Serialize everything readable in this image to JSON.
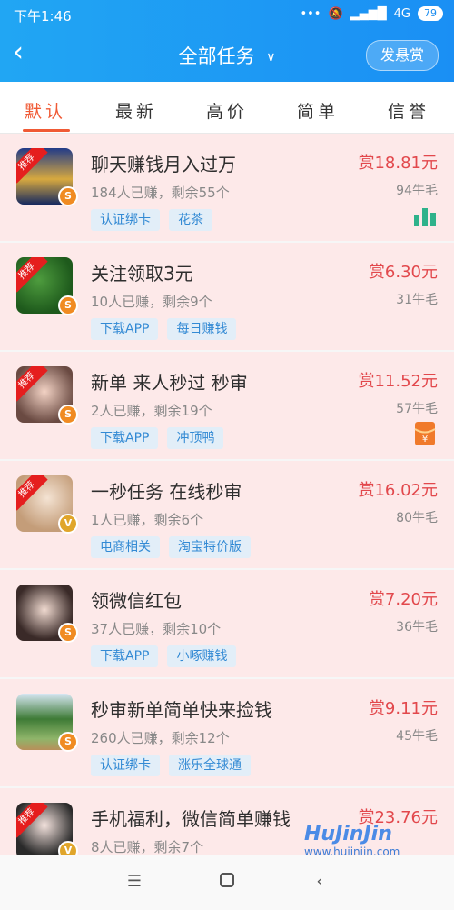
{
  "status": {
    "time": "下午1:46",
    "network": "4G",
    "battery": "79"
  },
  "header": {
    "title": "全部任务",
    "action": "发悬赏"
  },
  "tabs": [
    "默认",
    "最新",
    "高价",
    "简单",
    "信誉"
  ],
  "colors": {
    "brand": "#1d92f3",
    "accent": "#f05a35",
    "reward": "#e2484c",
    "tag_text": "#338ad4",
    "tag_bg": "#e2eef8"
  },
  "tasks": [
    {
      "title": "聊天赚钱月入过万",
      "stats": "184人已赚，剩余55个",
      "reward": "赏18.81元",
      "points": "94牛毛",
      "tags": [
        "认证绑卡",
        "花茶"
      ],
      "badge": "S",
      "ribbon": "推荐",
      "side_icon": "chart-icon"
    },
    {
      "title": "关注领取3元",
      "stats": "10人已赚，剩余9个",
      "reward": "赏6.30元",
      "points": "31牛毛",
      "tags": [
        "下载APP",
        "每日赚钱"
      ],
      "badge": "S",
      "ribbon": "推荐"
    },
    {
      "title": "新单 来人秒过 秒审",
      "stats": "2人已赚，剩余19个",
      "reward": "赏11.52元",
      "points": "57牛毛",
      "tags": [
        "下载APP",
        "冲顶鸭"
      ],
      "badge": "S",
      "ribbon": "推荐",
      "side_icon": "red-envelope-icon"
    },
    {
      "title": "一秒任务 在线秒审",
      "stats": "1人已赚，剩余6个",
      "reward": "赏16.02元",
      "points": "80牛毛",
      "tags": [
        "电商相关",
        "淘宝特价版"
      ],
      "badge": "V",
      "ribbon": "推荐"
    },
    {
      "title": "领微信红包",
      "stats": "37人已赚，剩余10个",
      "reward": "赏7.20元",
      "points": "36牛毛",
      "tags": [
        "下载APP",
        "小啄赚钱"
      ],
      "badge": "S"
    },
    {
      "title": "秒审新单简单快来捡钱",
      "stats": "260人已赚，剩余12个",
      "reward": "赏9.11元",
      "points": "45牛毛",
      "tags": [
        "认证绑卡",
        "涨乐全球通"
      ],
      "badge": "S"
    },
    {
      "title": "手机福利，微信简单赚钱",
      "stats": "8人已赚，剩余7个",
      "reward": "赏23.76元",
      "points": "",
      "tags": [],
      "badge": "V",
      "ribbon": "推荐"
    }
  ],
  "watermark": {
    "brand": "HuJinJin",
    "url": "www.hujinjin.com"
  },
  "bottom_nav": [
    "menu-icon",
    "home-icon",
    "back-icon"
  ]
}
